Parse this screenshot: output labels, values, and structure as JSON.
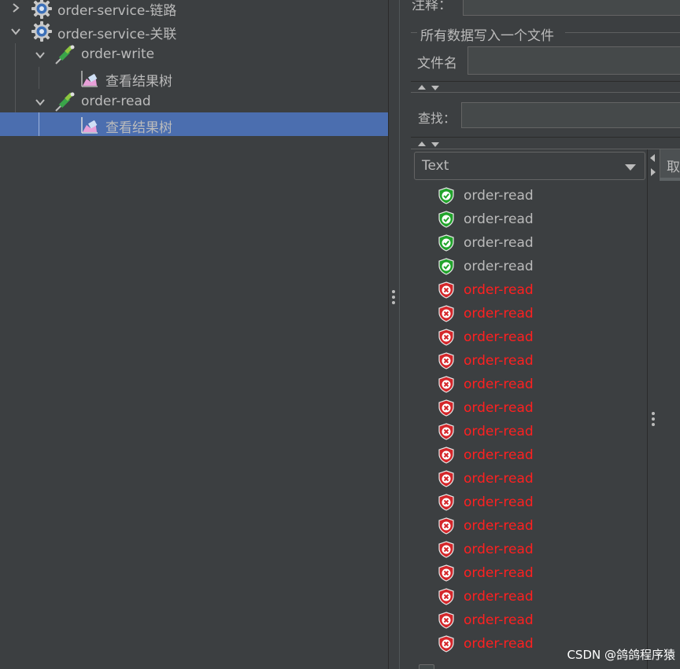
{
  "tree": {
    "items": [
      {
        "label": "order-service-链路",
        "icon": "gear-icon",
        "expanded": false
      },
      {
        "label": "order-service-关联",
        "icon": "gear-icon",
        "expanded": true
      },
      {
        "label": "order-write",
        "icon": "dropper-icon",
        "expanded": true
      },
      {
        "label": "查看结果树",
        "icon": "result-tree-icon"
      },
      {
        "label": "order-read",
        "icon": "dropper-icon",
        "expanded": true
      },
      {
        "label": "查看结果树",
        "icon": "result-tree-icon",
        "selected": true
      }
    ]
  },
  "right": {
    "comment_label": "注释：",
    "comment_value": "",
    "group_title": "所有数据写入一个文件",
    "filename_label": "文件名",
    "filename_value": "",
    "search_label": "查找：",
    "search_value": "",
    "renderer_selected": "Text",
    "side_button_label": "取"
  },
  "results": [
    {
      "name": "order-read",
      "status": "success"
    },
    {
      "name": "order-read",
      "status": "success"
    },
    {
      "name": "order-read",
      "status": "success"
    },
    {
      "name": "order-read",
      "status": "success"
    },
    {
      "name": "order-read",
      "status": "failure"
    },
    {
      "name": "order-read",
      "status": "failure"
    },
    {
      "name": "order-read",
      "status": "failure"
    },
    {
      "name": "order-read",
      "status": "failure"
    },
    {
      "name": "order-read",
      "status": "failure"
    },
    {
      "name": "order-read",
      "status": "failure"
    },
    {
      "name": "order-read",
      "status": "failure"
    },
    {
      "name": "order-read",
      "status": "failure"
    },
    {
      "name": "order-read",
      "status": "failure"
    },
    {
      "name": "order-read",
      "status": "failure"
    },
    {
      "name": "order-read",
      "status": "failure"
    },
    {
      "name": "order-read",
      "status": "failure"
    },
    {
      "name": "order-read",
      "status": "failure"
    },
    {
      "name": "order-read",
      "status": "failure"
    },
    {
      "name": "order-read",
      "status": "failure"
    },
    {
      "name": "order-read",
      "status": "failure"
    }
  ],
  "colors": {
    "background": "#3c3f41",
    "selection": "#4b6eaf",
    "text": "#bbbbbb",
    "failure_text": "#ff2020",
    "success_shield": "#21a32b",
    "failure_shield": "#d4262a"
  },
  "watermark": "CSDN @鸽鸽程序猿"
}
